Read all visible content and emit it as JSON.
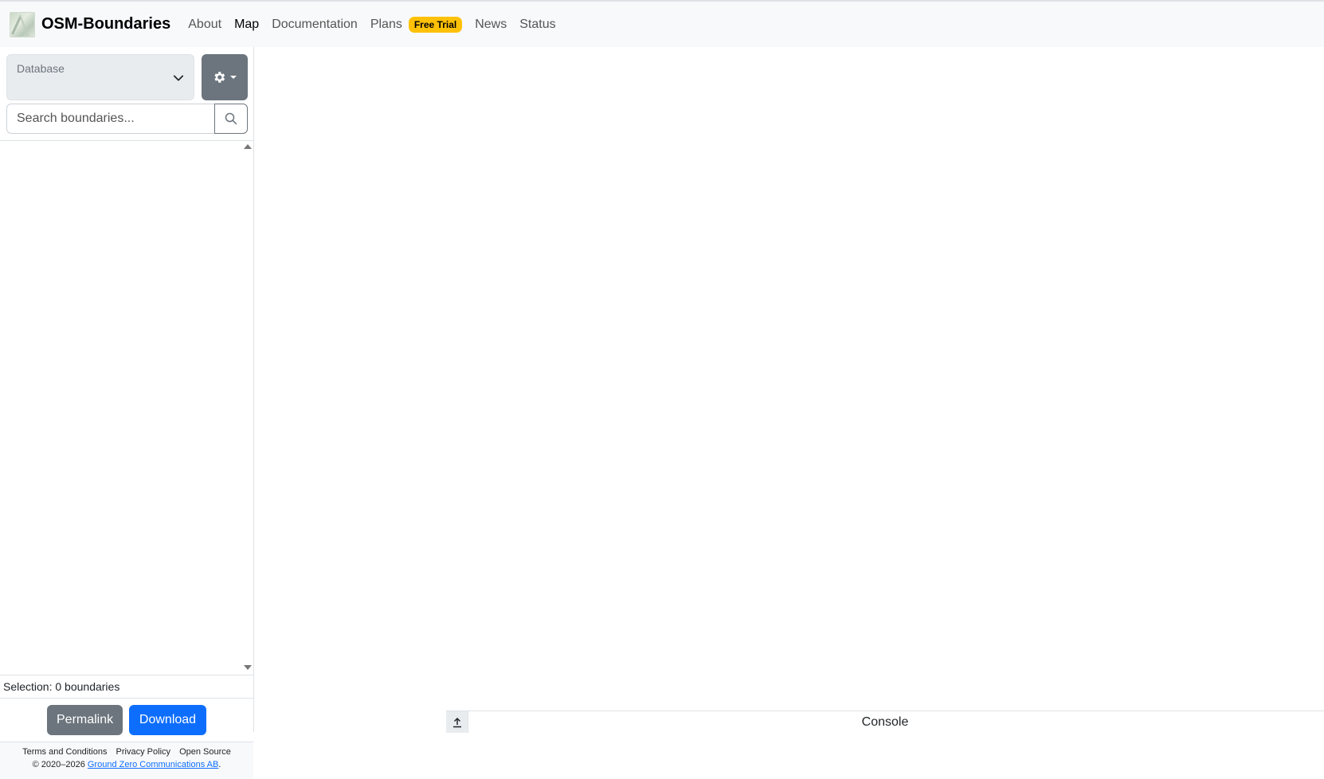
{
  "navbar": {
    "brand": "OSM-Boundaries",
    "links": [
      "About",
      "Map",
      "Documentation",
      "Plans"
    ],
    "badge": "Free Trial",
    "links_after": [
      "News",
      "Status"
    ],
    "active": "Map",
    "badge_color": "#ffc107"
  },
  "sidebar": {
    "database_label": "Database",
    "search_placeholder": "Search boundaries...",
    "selection_text": "Selection: 0 boundaries",
    "permalink_label": "Permalink",
    "download_label": "Download",
    "footer": {
      "terms": "Terms and Conditions",
      "privacy": "Privacy Policy",
      "open_source": "Open Source",
      "copyright_prefix": "© 2020–2026 ",
      "company": "Ground Zero Communications AB",
      "copyright_suffix": "."
    }
  },
  "console": {
    "label": "Console"
  },
  "colors": {
    "primary": "#0d6efd",
    "secondary": "#6c757d",
    "navbar_bg": "#f8f9fa"
  }
}
